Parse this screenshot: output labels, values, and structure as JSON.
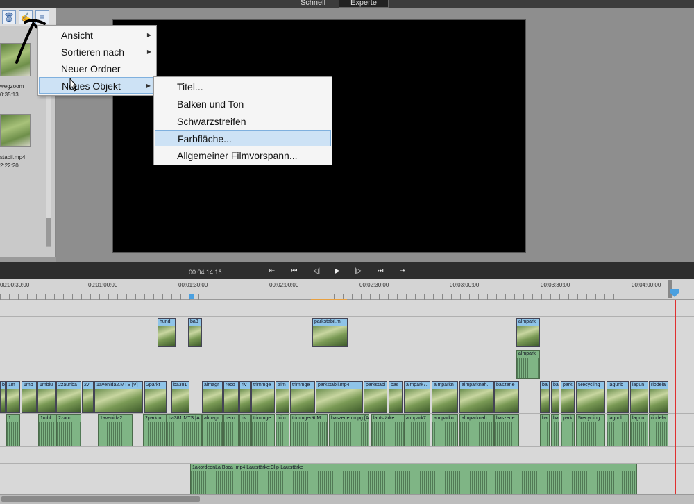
{
  "header": {
    "mode_quick": "Schnell",
    "mode_expert": "Experte"
  },
  "media": [
    {
      "name": "wegzoom",
      "duration": "0:35:13"
    },
    {
      "name": "stabil.mp4",
      "duration": "2:22:20"
    }
  ],
  "transport": {
    "timecode": "00:04:14:16",
    "controls": [
      "⇤",
      "⏮",
      "◁|",
      "▶",
      "|▷",
      "⏭",
      "⇥"
    ]
  },
  "ruler": [
    "00:00:30:00",
    "00:01:00:00",
    "00:01:30:00",
    "00:02:00:00",
    "00:02:30:00",
    "00:03:00:00",
    "00:03:30:00",
    "00:04:00:00"
  ],
  "tracks": {
    "video2": [
      "hund",
      "ba3",
      "parkstabil.m",
      "almpark"
    ],
    "audio2": [
      "almpark"
    ],
    "video1": [
      "ba",
      "1m",
      "1mb",
      "1mblu",
      "2zaunba",
      "2v",
      "1avenida2.MTS [V]",
      "2parkt",
      "ba381",
      "almagr",
      "reco",
      "riv",
      "trimmge",
      "trim",
      "trimmge",
      "parkstabil.mp4",
      "parkstabi",
      "bas",
      "almpark7.",
      "almparkn",
      "almparknah.",
      "baszene",
      "ba",
      "ba",
      "park",
      "5recycling",
      "lagunb",
      "lagun",
      "riodela"
    ],
    "audio1": [
      "1",
      "1mbl",
      "2zaun",
      "1avenida2",
      "2parkto",
      "ba381.MTS [A",
      "almagr",
      "reco",
      "riv",
      "trimmge",
      "trim",
      "trimmgerät.M",
      "baszenen.mpg [A]",
      "lautstärke",
      "almpark7.",
      "almparkn",
      "almparknah.",
      "baszene",
      "ba",
      "ba",
      "park",
      "5recycling",
      "lagunb",
      "lagun",
      "riodela"
    ],
    "soundtrack": "1akordeonLa Boca .mp4",
    "soundtrack_fx": "Lautstärke:Clip-Lautstärke"
  },
  "menu1": [
    {
      "label": "Ansicht",
      "submenu": true
    },
    {
      "label": "Sortieren nach",
      "submenu": true
    },
    {
      "label": "Neuer Ordner",
      "submenu": false
    },
    {
      "label": "Neues Objekt",
      "submenu": true
    }
  ],
  "menu2": [
    "Titel...",
    "Balken und Ton",
    "Schwarzstreifen",
    "Farbfläche...",
    "Allgemeiner Filmvorspann..."
  ],
  "icons": {
    "trash": "trash-icon",
    "pin": "pin-icon",
    "menu": "panel-menu-icon"
  },
  "colors": {
    "video_clip_header": "#8fc4e8",
    "audio_clip": "#7fb585",
    "playhead": "#e03030",
    "menu_highlight": "#cde2f5"
  }
}
